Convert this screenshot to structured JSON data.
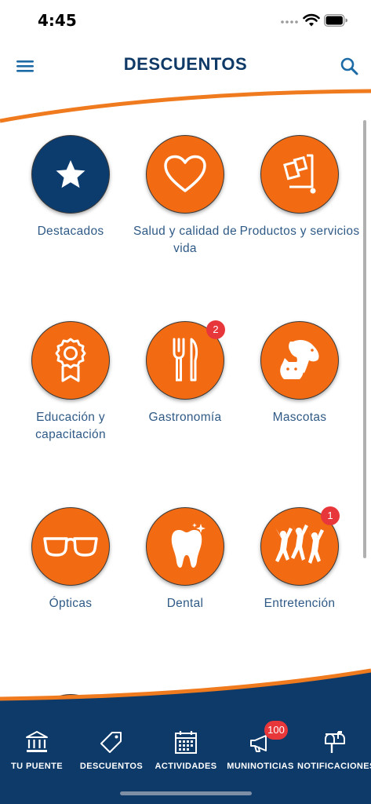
{
  "status_bar": {
    "time": "4:45"
  },
  "header": {
    "title": "DESCUENTOS",
    "menu_icon": "hamburger-menu-icon",
    "search_icon": "search-icon"
  },
  "categories": [
    {
      "label": "Destacados",
      "icon": "star-icon",
      "color": "#0c3b6d"
    },
    {
      "label": "Salud y calidad de vida",
      "icon": "heart-icon",
      "color": "#f26b12"
    },
    {
      "label": "Productos y servicios",
      "icon": "shopping-cart-icon",
      "color": "#f26b12"
    },
    {
      "label": "Educación y capacitación",
      "icon": "award-ribbon-icon",
      "color": "#f26b12"
    },
    {
      "label": "Gastronomía",
      "icon": "fork-knife-icon",
      "color": "#f26b12",
      "badge": "2"
    },
    {
      "label": "Mascotas",
      "icon": "dog-cat-icon",
      "color": "#f26b12"
    },
    {
      "label": "Ópticas",
      "icon": "glasses-icon",
      "color": "#f26b12"
    },
    {
      "label": "Dental",
      "icon": "tooth-icon",
      "color": "#f26b12"
    },
    {
      "label": "Entretención",
      "icon": "dancing-people-icon",
      "color": "#f26b12",
      "badge": "1"
    }
  ],
  "tabs": [
    {
      "label": "TU PUENTE",
      "icon": "bank-building-icon"
    },
    {
      "label": "DESCUENTOS",
      "icon": "price-tag-icon"
    },
    {
      "label": "ACTIVIDADES",
      "icon": "calendar-icon"
    },
    {
      "label": "MUNINOTICIAS",
      "icon": "megaphone-icon",
      "badge": "100"
    },
    {
      "label": "NOTIFICACIONES",
      "icon": "mailbox-icon"
    }
  ],
  "colors": {
    "accent": "#f26b12",
    "brand": "#0d3a69",
    "badge": "#e8373a"
  }
}
